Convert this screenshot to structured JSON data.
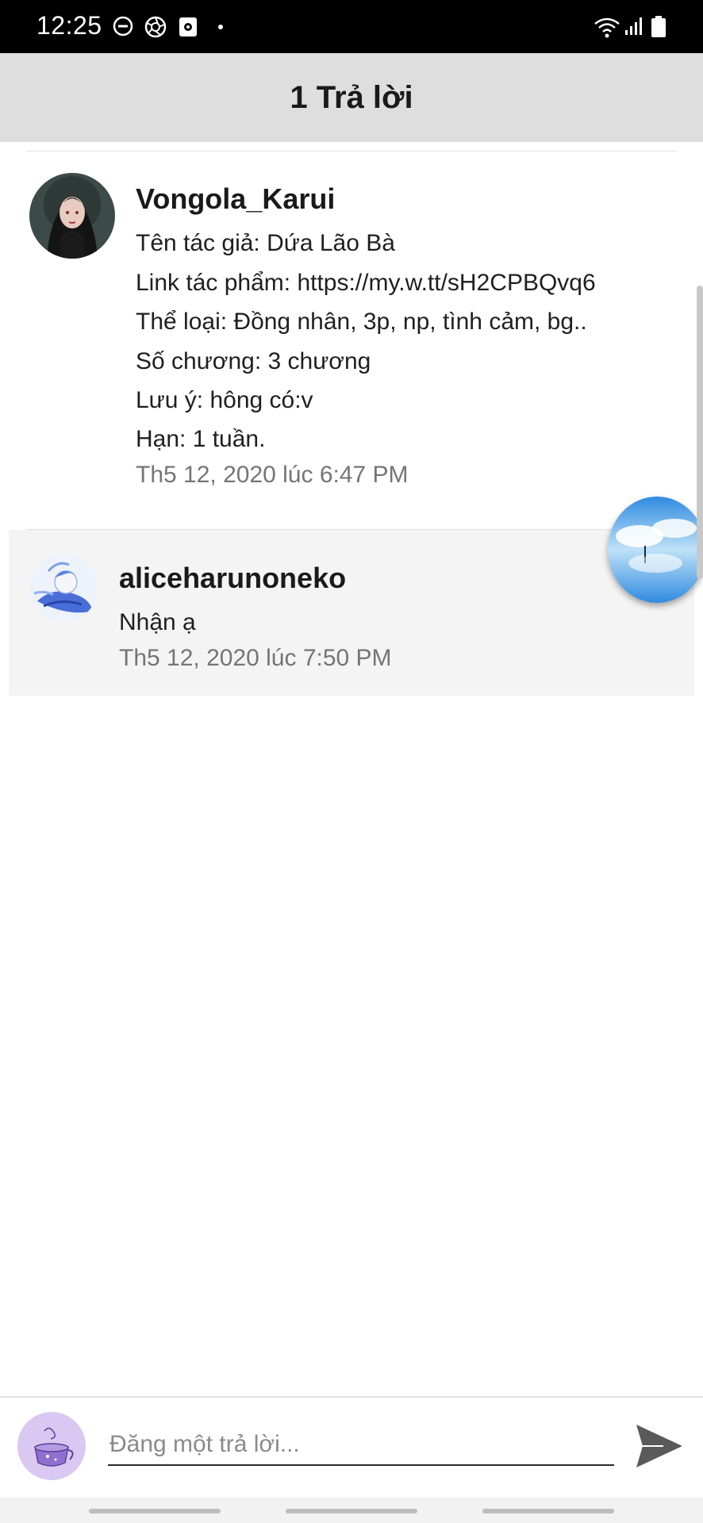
{
  "status_bar": {
    "time": "12:25",
    "icons": [
      "do-not-disturb-icon",
      "aperture-icon",
      "screen-record-icon",
      "notification-dot-icon",
      "wifi-icon",
      "signal-icon",
      "battery-icon"
    ]
  },
  "header": {
    "title": "1 Trả lời"
  },
  "comments": [
    {
      "username": "Vongola_Karui",
      "lines": [
        "Tên tác giả: Dứa Lão Bà",
        "Link tác phẩm: https://my.w.tt/sH2CPBQvq6",
        "Thể loại: Đồng nhân, 3p, np, tình cảm, bg..",
        "Số chương: 3 chương",
        "Lưu ý: hông có:v",
        "Hạn: 1 tuần."
      ],
      "timestamp": "Th5 12, 2020 lúc 6:47 PM"
    },
    {
      "username": "aliceharunoneko",
      "lines": [
        "Nhận ạ"
      ],
      "timestamp": "Th5 12, 2020 lúc 7:50 PM"
    }
  ],
  "composer": {
    "placeholder": "Đăng một trả lời..."
  },
  "colors": {
    "header_bg": "#dedede",
    "highlight_bg": "#f4f4f4",
    "timestamp": "#757575",
    "send_icon": "#5a5a5a"
  }
}
